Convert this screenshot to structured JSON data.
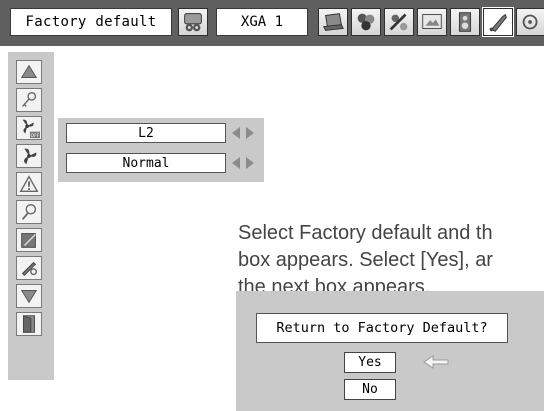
{
  "menu_bar": {
    "title": "Factory default",
    "source": "XGA 1",
    "icons": [
      "projector-audio-icon",
      "computer-input-icon",
      "image-select-icon",
      "image-adjust-icon",
      "screen-icon",
      "sound-icon",
      "setting-icon"
    ],
    "selected_icon": "setting-icon"
  },
  "sidebar": {
    "icons": [
      "move-up-icon",
      "key-icon",
      "fan-off-icon",
      "fan-icon",
      "warning-icon",
      "lamp-icon",
      "filter-icon",
      "tool-icon",
      "move-down-icon",
      "exit-icon"
    ]
  },
  "options": [
    {
      "value": "L2"
    },
    {
      "value": "Normal"
    }
  ],
  "instructions": {
    "lines": [
      "Select Factory default and th",
      "box appears. Select [Yes], ar",
      "the next box appears."
    ]
  },
  "dialog": {
    "message": "Return to Factory Default?",
    "yes_label": "Yes",
    "no_label": "No",
    "pointer_icon": "left-arrow-pointer-icon"
  },
  "colors": {
    "menu_bar": "#5f5f5f",
    "panel": "#c9c9c9",
    "arrow_gray": "#8c8c8c",
    "text_gray": "#444444"
  }
}
